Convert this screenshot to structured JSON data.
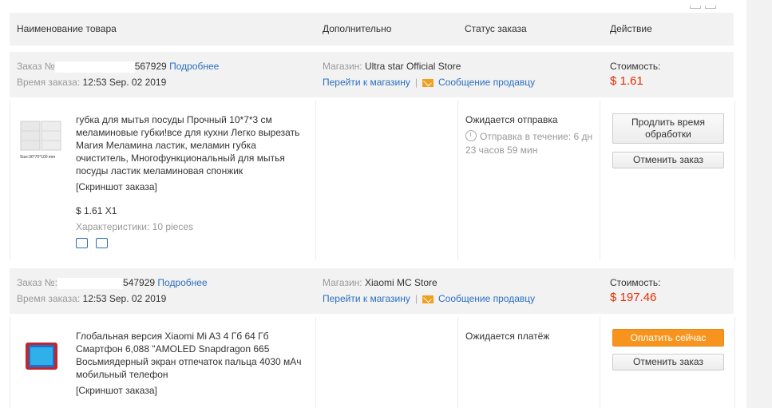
{
  "header": {
    "col_product": "Наименование товара",
    "col_extra": "Дополнительно",
    "col_status": "Статус заказа",
    "col_action": "Действие"
  },
  "orders": [
    {
      "order_prefix": "Заказ №",
      "order_tail": "567929",
      "details_link": "Подробнее",
      "time_label": "Время заказа:",
      "time_value": "12:53 Sep. 02 2019",
      "store_label": "Магазин:",
      "store_name": "Ultra star Official Store",
      "go_store": "Перейти к магазину",
      "message_seller": "Сообщение продавцу",
      "cost_label": "Стоимость:",
      "cost_value": "$ 1.61",
      "product_title": "губка для мытья посуды Прочный 10*7*3 см меламиновые губки!все для кухни Легко вырезать Магия Меламина ластик, меламин губка очиститель, Многофункциональный для мытья посуды ластик меламиновая спонжик",
      "screenshot_link": "[Скриншот заказа]",
      "price_qty": "$ 1.61 X1",
      "specs": "Характеристики: 10 pieces",
      "thumb_caption": "Size:30*70*100 mm",
      "status_text": "Ожидается отправка",
      "status_timer": "Отправка в течение: 6 дн 23 часов 59 мин",
      "btn_primary": "Продлить время обработки",
      "btn_secondary": "Отменить заказ"
    },
    {
      "order_prefix": "Заказ №:",
      "order_tail": "547929",
      "details_link": "Подробнее",
      "time_label": "Время заказа:",
      "time_value": "12:53 Sep. 02 2019",
      "store_label": "Магазин:",
      "store_name": "Xiaomi MC Store",
      "go_store": "Перейти к магазину",
      "message_seller": "Сообщение продавцу",
      "cost_label": "Стоимость:",
      "cost_value": "$ 197.46",
      "product_title": "Глобальная версия Xiaomi Mi A3 4 Гб 64 Гб Смартфон 6,088 \"AMOLED Snapdragon 665 Восьмиядерный экран отпечаток пальца 4030 мАч мобильный телефон",
      "screenshot_link": "[Скриншот заказа]",
      "status_text": "Ожидается платёж",
      "btn_primary": "Оплатить сейчас",
      "btn_secondary": "Отменить заказ"
    }
  ],
  "colors": {
    "accent": "#f7941d",
    "price": "#e62e04",
    "link": "#2a6fc2"
  },
  "icons": [
    "truck-icon",
    "return-icon",
    "mail-icon",
    "clock-icon"
  ]
}
